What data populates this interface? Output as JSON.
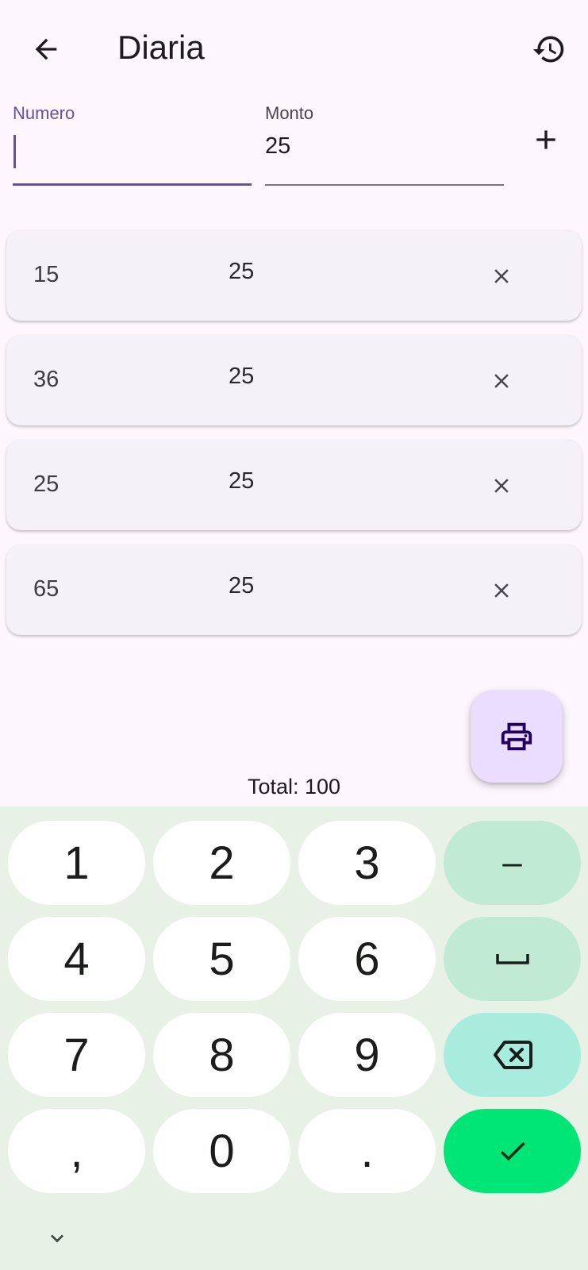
{
  "appbar": {
    "title": "Diaria",
    "back_icon": "arrow-back-icon",
    "history_icon": "history-icon"
  },
  "form": {
    "numero": {
      "label": "Numero",
      "value": ""
    },
    "monto": {
      "label": "Monto",
      "value": "25"
    },
    "add_icon": "plus-icon"
  },
  "entries": [
    {
      "numero": "15",
      "monto": "25"
    },
    {
      "numero": "36",
      "monto": "25"
    },
    {
      "numero": "25",
      "monto": "25"
    },
    {
      "numero": "65",
      "monto": "25"
    }
  ],
  "fab": {
    "icon": "print-icon"
  },
  "total": {
    "text": "Total: 100"
  },
  "keyboard": {
    "keys": [
      "1",
      "2",
      "3",
      "–",
      "4",
      "5",
      "6",
      "␣",
      "7",
      "8",
      "9",
      "⌫",
      ",",
      "0",
      ".",
      "✓"
    ],
    "digit_keys": {
      "k1": "1",
      "k2": "2",
      "k3": "3",
      "k4": "4",
      "k5": "5",
      "k6": "6",
      "k7": "7",
      "k8": "8",
      "k9": "9",
      "comma": ",",
      "k0": "0",
      "period": "."
    },
    "minus": "–",
    "colors": {
      "bg": "#e8f1e6",
      "key": "#ffffff",
      "fn": "#c1ead5",
      "backspace": "#a8ecdd",
      "enter": "#00e676"
    }
  },
  "colors": {
    "accent": "#6750a4",
    "background": "#fdf6fd",
    "card": "#f5f1f8",
    "fab": "#eaddff"
  }
}
